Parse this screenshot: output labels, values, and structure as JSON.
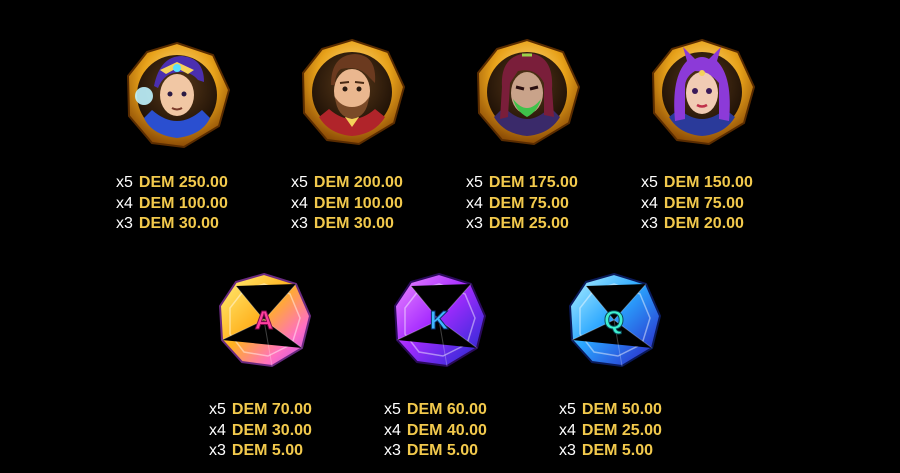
{
  "currency": "DEM",
  "colors": {
    "background": "#000000",
    "amount": "#f2c94c",
    "multiplier": "#ffffff",
    "gold_frame": "#e8a21a"
  },
  "symbols": [
    {
      "icon": "hero-blue-hair-icon",
      "payouts": [
        {
          "count": "x5",
          "amount": "DEM 250.00"
        },
        {
          "count": "x4",
          "amount": "DEM 100.00"
        },
        {
          "count": "x3",
          "amount": "DEM 30.00"
        }
      ]
    },
    {
      "icon": "hero-bearded-man-icon",
      "payouts": [
        {
          "count": "x5",
          "amount": "DEM 200.00"
        },
        {
          "count": "x4",
          "amount": "DEM 100.00"
        },
        {
          "count": "x3",
          "amount": "DEM 30.00"
        }
      ]
    },
    {
      "icon": "villain-masked-woman-icon",
      "payouts": [
        {
          "count": "x5",
          "amount": "DEM 175.00"
        },
        {
          "count": "x4",
          "amount": "DEM 75.00"
        },
        {
          "count": "x3",
          "amount": "DEM 25.00"
        }
      ]
    },
    {
      "icon": "villain-purple-hair-woman-icon",
      "payouts": [
        {
          "count": "x5",
          "amount": "DEM 150.00"
        },
        {
          "count": "x4",
          "amount": "DEM 75.00"
        },
        {
          "count": "x3",
          "amount": "DEM 20.00"
        }
      ]
    },
    {
      "icon": "gem-a-icon",
      "letter": "A",
      "payouts": [
        {
          "count": "x5",
          "amount": "DEM 70.00"
        },
        {
          "count": "x4",
          "amount": "DEM 30.00"
        },
        {
          "count": "x3",
          "amount": "DEM 5.00"
        }
      ]
    },
    {
      "icon": "gem-k-icon",
      "letter": "K",
      "payouts": [
        {
          "count": "x5",
          "amount": "DEM 60.00"
        },
        {
          "count": "x4",
          "amount": "DEM 40.00"
        },
        {
          "count": "x3",
          "amount": "DEM 5.00"
        }
      ]
    },
    {
      "icon": "gem-q-icon",
      "letter": "Q",
      "payouts": [
        {
          "count": "x5",
          "amount": "DEM 50.00"
        },
        {
          "count": "x4",
          "amount": "DEM 25.00"
        },
        {
          "count": "x3",
          "amount": "DEM 5.00"
        }
      ]
    }
  ]
}
